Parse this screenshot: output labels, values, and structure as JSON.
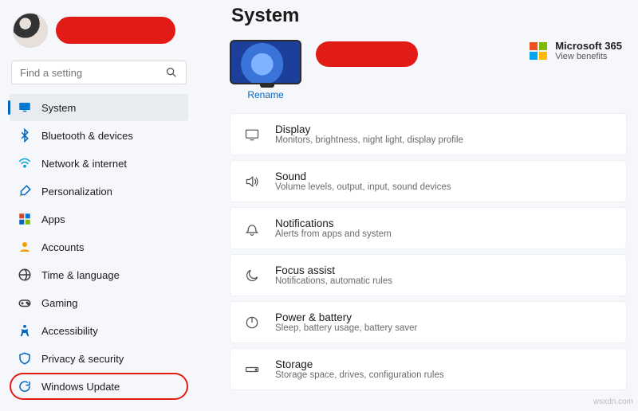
{
  "page_title": "System",
  "search": {
    "placeholder": "Find a setting"
  },
  "sidebar": {
    "items": [
      {
        "label": "System",
        "icon": "monitor-icon",
        "color": "#0078d4"
      },
      {
        "label": "Bluetooth & devices",
        "icon": "bluetooth-icon",
        "color": "#0067c0"
      },
      {
        "label": "Network & internet",
        "icon": "wifi-icon",
        "color": "#00a3da"
      },
      {
        "label": "Personalization",
        "icon": "brush-icon",
        "color": "#0067c0"
      },
      {
        "label": "Apps",
        "icon": "apps-icon",
        "color": "#d24726"
      },
      {
        "label": "Accounts",
        "icon": "person-icon",
        "color": "#f2a100"
      },
      {
        "label": "Time & language",
        "icon": "clock-globe-icon",
        "color": "#3a3a3a"
      },
      {
        "label": "Gaming",
        "icon": "gamepad-icon",
        "color": "#3a3a3a"
      },
      {
        "label": "Accessibility",
        "icon": "accessibility-icon",
        "color": "#0067c0"
      },
      {
        "label": "Privacy & security",
        "icon": "shield-icon",
        "color": "#0067c0"
      },
      {
        "label": "Windows Update",
        "icon": "update-icon",
        "color": "#0067c0"
      }
    ]
  },
  "device": {
    "rename_label": "Rename"
  },
  "promo": {
    "title": "Microsoft 365",
    "sub": "View benefits"
  },
  "settings": [
    {
      "title": "Display",
      "sub": "Monitors, brightness, night light, display profile"
    },
    {
      "title": "Sound",
      "sub": "Volume levels, output, input, sound devices"
    },
    {
      "title": "Notifications",
      "sub": "Alerts from apps and system"
    },
    {
      "title": "Focus assist",
      "sub": "Notifications, automatic rules"
    },
    {
      "title": "Power & battery",
      "sub": "Sleep, battery usage, battery saver"
    },
    {
      "title": "Storage",
      "sub": "Storage space, drives, configuration rules"
    }
  ],
  "watermark": "wsxdn.com"
}
